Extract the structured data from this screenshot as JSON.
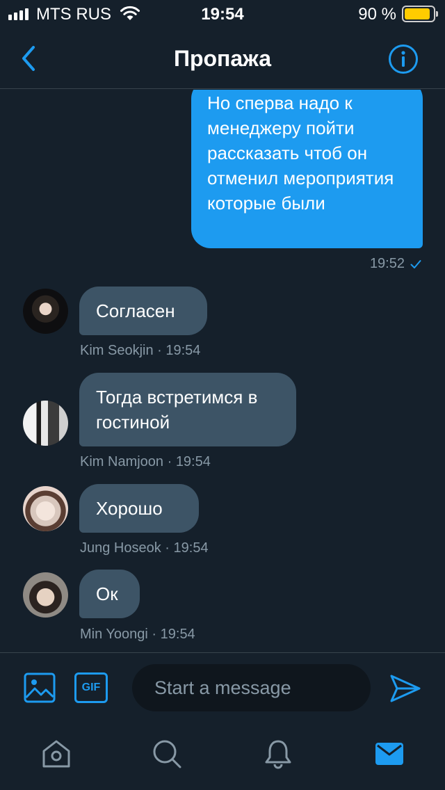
{
  "status_bar": {
    "carrier": "MTS RUS",
    "time": "19:54",
    "battery": "90 %",
    "battery_level": 0.9
  },
  "header": {
    "title": "Пропажа",
    "back_icon": "chevron-left-icon",
    "info_icon": "info-icon"
  },
  "messages": {
    "sent": {
      "text": "Но сперва надо к менеджеру пойти рассказать чтоб он отменил мероприятия которые были",
      "time": "19:52"
    },
    "received": [
      {
        "text": "Согласен",
        "meta": "Kim Seokjin · 19:54"
      },
      {
        "text": "Тогда встретимся в гостиной",
        "meta": "Kim Namjoon · 19:54"
      },
      {
        "text": "Хорошо",
        "meta": "Jung Hoseok · 19:54"
      },
      {
        "text": "Ок",
        "meta": "Min Yoongi · 19:54"
      }
    ]
  },
  "composer": {
    "placeholder": "Start a message",
    "gif_label": "GIF"
  },
  "tabs": [
    "home-icon",
    "search-icon",
    "notifications-icon",
    "messages-icon"
  ],
  "colors": {
    "background": "#15202b",
    "accent": "#1d9bf0",
    "incoming_bubble": "#3d5466",
    "muted_text": "#8899a6",
    "battery": "#ffcc00"
  }
}
